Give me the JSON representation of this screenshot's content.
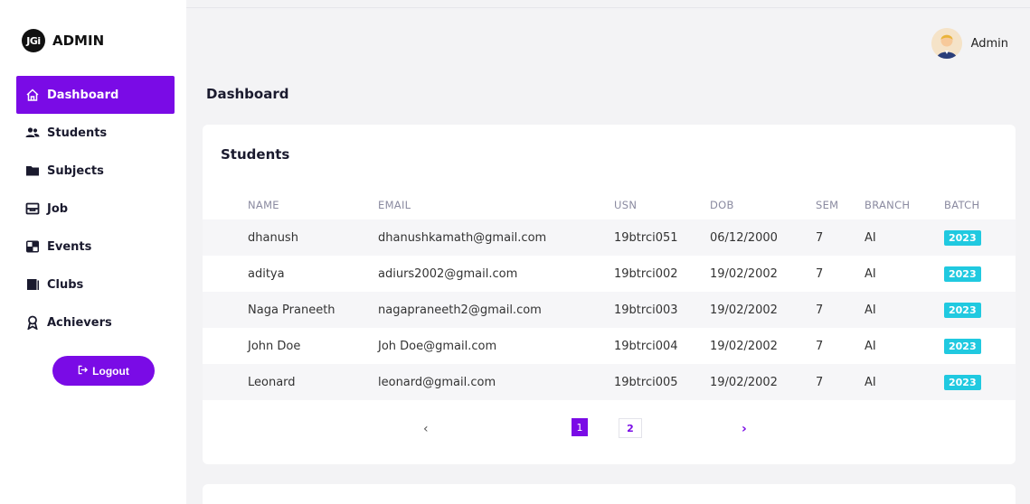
{
  "brand": {
    "logo_text": "JGi",
    "title": "ADMIN"
  },
  "sidebar": {
    "items": [
      {
        "label": "Dashboard",
        "icon": "home-icon",
        "active": true
      },
      {
        "label": "Students",
        "icon": "users-icon"
      },
      {
        "label": "Subjects",
        "icon": "folder-icon"
      },
      {
        "label": "Job",
        "icon": "briefcase-icon"
      },
      {
        "label": "Events",
        "icon": "events-icon"
      },
      {
        "label": "Clubs",
        "icon": "book-icon"
      },
      {
        "label": "Achievers",
        "icon": "award-icon"
      }
    ],
    "logout_label": "Logout"
  },
  "header": {
    "user_name": "Admin"
  },
  "page": {
    "title": "Dashboard"
  },
  "students_card": {
    "title": "Students",
    "columns": [
      "NAME",
      "EMAIL",
      "USN",
      "DOB",
      "SEM",
      "BRANCH",
      "BATCH"
    ],
    "rows": [
      {
        "name": "dhanush",
        "email": "dhanushkamath@gmail.com",
        "usn": "19btrci051",
        "dob": "06/12/2000",
        "sem": "7",
        "branch": "AI",
        "batch": "2023"
      },
      {
        "name": "aditya",
        "email": "adiurs2002@gmail.com",
        "usn": "19btrci002",
        "dob": "19/02/2002",
        "sem": "7",
        "branch": "AI",
        "batch": "2023"
      },
      {
        "name": "Naga Praneeth",
        "email": "nagapraneeth2@gmail.com",
        "usn": "19btrci003",
        "dob": "19/02/2002",
        "sem": "7",
        "branch": "AI",
        "batch": "2023"
      },
      {
        "name": "John Doe",
        "email": "Joh Doe@gmail.com",
        "usn": "19btrci004",
        "dob": "19/02/2002",
        "sem": "7",
        "branch": "AI",
        "batch": "2023"
      },
      {
        "name": "Leonard",
        "email": "leonard@gmail.com",
        "usn": "19btrci005",
        "dob": "19/02/2002",
        "sem": "7",
        "branch": "AI",
        "batch": "2023"
      }
    ],
    "pagination": {
      "prev": "‹",
      "pages": [
        "1",
        "2"
      ],
      "current": "1",
      "next": "›"
    }
  },
  "colors": {
    "accent": "#7a0be6",
    "badge": "#20c9e0"
  }
}
